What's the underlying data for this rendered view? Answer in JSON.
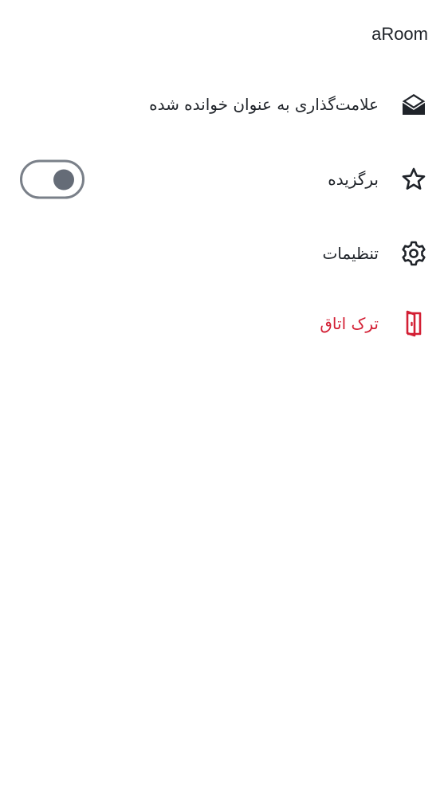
{
  "room": {
    "title": "aRoom"
  },
  "menu": {
    "items": [
      {
        "label": "علامت‌گذاری به عنوان خوانده شده",
        "icon": "envelope-open-icon"
      },
      {
        "label": "برگزیده",
        "icon": "star-icon",
        "toggle": {
          "checked": false
        }
      },
      {
        "label": "تنظیمات",
        "icon": "gear-icon"
      },
      {
        "label": "ترک اتاق",
        "icon": "leave-door-icon",
        "color": "#d31f34"
      }
    ]
  },
  "colors": {
    "text": "#1f2329",
    "danger": "#d31f34",
    "toggle_border": "#7a8089",
    "toggle_knob": "#656c77"
  }
}
